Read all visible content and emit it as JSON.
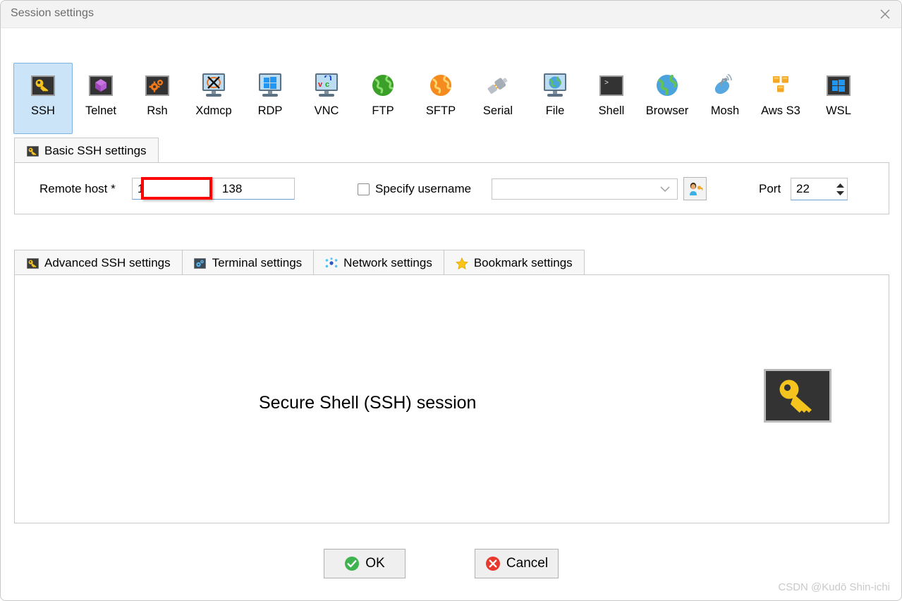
{
  "window": {
    "title": "Session settings",
    "close_icon": "close-icon"
  },
  "protocols": [
    {
      "id": "ssh",
      "label": "SSH",
      "icon": "key-icon",
      "selected": true
    },
    {
      "id": "telnet",
      "label": "Telnet",
      "icon": "purple-cube-icon",
      "selected": false
    },
    {
      "id": "rsh",
      "label": "Rsh",
      "icon": "orange-gears-icon",
      "selected": false
    },
    {
      "id": "xdmcp",
      "label": "Xdmcp",
      "icon": "x-monitor-icon",
      "selected": false
    },
    {
      "id": "rdp",
      "label": "RDP",
      "icon": "windows-monitor-icon",
      "selected": false
    },
    {
      "id": "vnc",
      "label": "VNC",
      "icon": "vnc-monitor-icon",
      "selected": false
    },
    {
      "id": "ftp",
      "label": "FTP",
      "icon": "green-globe-icon",
      "selected": false
    },
    {
      "id": "sftp",
      "label": "SFTP",
      "icon": "orange-globe-icon",
      "selected": false
    },
    {
      "id": "serial",
      "label": "Serial",
      "icon": "plug-icon",
      "selected": false
    },
    {
      "id": "file",
      "label": "File",
      "icon": "globe-monitor-icon",
      "selected": false
    },
    {
      "id": "shell",
      "label": "Shell",
      "icon": "terminal-prompt-icon",
      "selected": false
    },
    {
      "id": "browser",
      "label": "Browser",
      "icon": "blue-globe-icon",
      "selected": false
    },
    {
      "id": "mosh",
      "label": "Mosh",
      "icon": "satellite-dish-icon",
      "selected": false
    },
    {
      "id": "awss3",
      "label": "Aws S3",
      "icon": "aws-cubes-icon",
      "selected": false
    },
    {
      "id": "wsl",
      "label": "WSL",
      "icon": "windows-logo-icon",
      "selected": false
    }
  ],
  "basic_tab": {
    "label": "Basic SSH settings",
    "icon": "key-icon",
    "remote_host": {
      "label": "Remote host *",
      "value_prefix": "19",
      "value_suffix": "138",
      "redacted": true
    },
    "specify_username": {
      "label": "Specify username",
      "checked": false,
      "value": "",
      "dropdown_icon": "chevron-down-icon",
      "user_key_button_icon": "user-key-icon"
    },
    "port": {
      "label": "Port",
      "value": "22",
      "spinner_up_icon": "caret-up-icon",
      "spinner_down_icon": "caret-down-icon"
    }
  },
  "setting_tabs": [
    {
      "id": "advanced",
      "label": "Advanced SSH settings",
      "icon": "key-icon",
      "active": false
    },
    {
      "id": "terminal",
      "label": "Terminal settings",
      "icon": "gears-icon",
      "active": false
    },
    {
      "id": "network",
      "label": "Network settings",
      "icon": "network-icon",
      "active": false
    },
    {
      "id": "bookmark",
      "label": "Bookmark settings",
      "icon": "star-icon",
      "active": false
    }
  ],
  "content": {
    "session_title": "Secure Shell (SSH) session",
    "big_icon": "key-icon"
  },
  "footer": {
    "ok_label": "OK",
    "ok_icon": "green-check-icon",
    "cancel_label": "Cancel",
    "cancel_icon": "red-cross-icon"
  },
  "watermark": "CSDN @Kudō Shin-ichi",
  "colors": {
    "selection_bg": "#cce4f7",
    "selection_border": "#7eb4e2",
    "redaction": "#ff0000",
    "ok_green": "#3eb34f",
    "cancel_red": "#e8392e",
    "key_yellow": "#f5c31e"
  }
}
